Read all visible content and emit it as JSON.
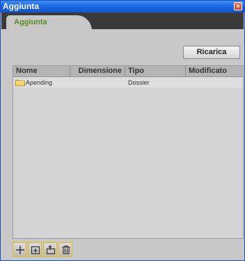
{
  "window": {
    "title": "Aggiunta",
    "close_icon": "close-icon"
  },
  "tab": {
    "label": "Aggiunta"
  },
  "reload_button": {
    "label": "Ricarica"
  },
  "grid": {
    "columns": [
      "Nome",
      "Dimensione",
      "Tipo",
      "Modificato"
    ],
    "rows": [
      {
        "name": "Apending",
        "size": "",
        "type": "Dossier",
        "modified": "",
        "icon": "folder-icon"
      }
    ]
  },
  "toolbar": {
    "buttons": [
      {
        "icon": "add-icon"
      },
      {
        "icon": "new-folder-icon"
      },
      {
        "icon": "upload-icon"
      },
      {
        "icon": "trash-icon"
      }
    ]
  },
  "colors": {
    "title_bar": "#1a62df",
    "tab_text": "#5c8d1c",
    "toolbar_border": "#e6b800"
  }
}
